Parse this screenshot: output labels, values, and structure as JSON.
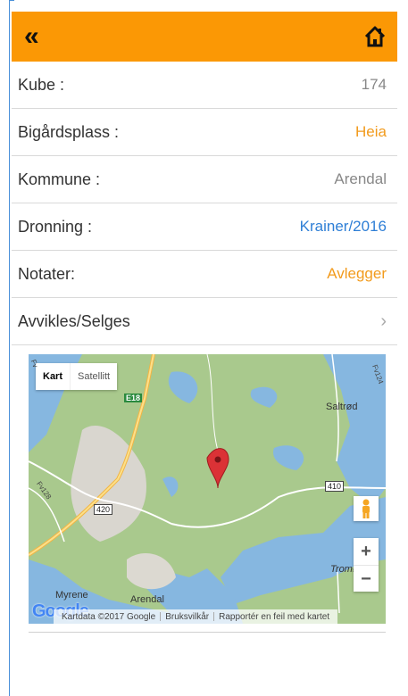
{
  "header": {
    "back_icon": "double-chevron-left-icon",
    "back_glyph": "«",
    "home_icon": "home-icon",
    "color": "#fb9805"
  },
  "rows": [
    {
      "label": "Kube :",
      "value": "174",
      "color": "#888888"
    },
    {
      "label": "Bigårdsplass :",
      "value": "Heia",
      "color": "#f29b1d"
    },
    {
      "label": "Kommune :",
      "value": "Arendal",
      "color": "#888888"
    },
    {
      "label": "Dronning :",
      "value": "Krainer/2016",
      "color": "#2f7fd6"
    },
    {
      "label": "Notater:",
      "value": "Avlegger",
      "color": "#f29b1d"
    }
  ],
  "action_row": {
    "label": "Avvikles/Selges",
    "chevron": "›"
  },
  "map": {
    "type_controls": {
      "map": "Kart",
      "satellite": "Satellitt"
    },
    "places": {
      "saltrod": "Saltrød",
      "tromoy": "Tromøy",
      "myrene": "Myrene",
      "arendal": "Arendal"
    },
    "roads": {
      "e18": "E18",
      "r410": "410",
      "r420": "420",
      "fv128": "Fv128",
      "fv124": "Fv124",
      "fv": "Fv"
    },
    "zoom_in": "+",
    "zoom_out": "−",
    "logo": "Google",
    "attribution": {
      "data": "Kartdata ©2017 Google",
      "terms": "Bruksvilkår",
      "report": "Rapportér en feil med kartet"
    }
  }
}
